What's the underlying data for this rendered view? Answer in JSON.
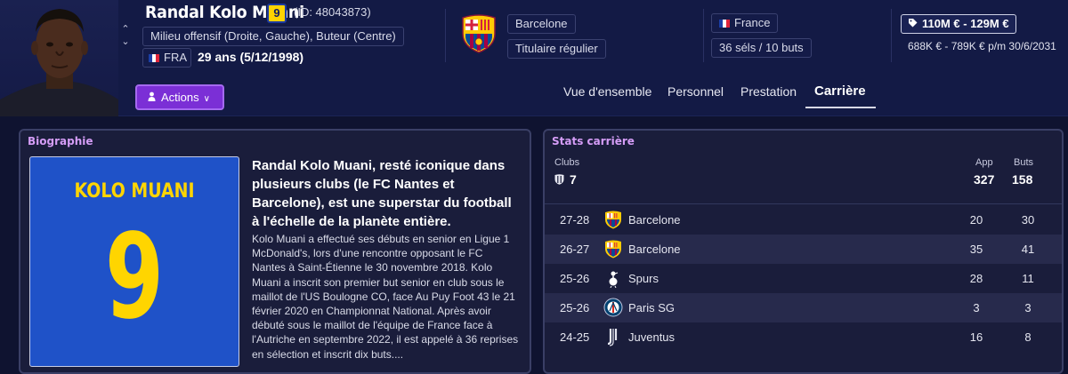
{
  "player": {
    "name": "Randal Kolo Muani",
    "shirt_number": "9",
    "id_text": "(ID: 48043873)",
    "position": "Milieu offensif (Droite, Gauche), Buteur (Centre)",
    "nationality_code": "FRA",
    "age": "29 ans (5/12/1998)"
  },
  "actions": {
    "label": "Actions"
  },
  "club": {
    "name": "Barcelone",
    "status": "Titulaire régulier",
    "crest_icon": "fc-barcelona-crest-icon"
  },
  "national_team": {
    "country": "France",
    "caps_goals": "36 séls / 10 buts"
  },
  "value": {
    "range": "110M € - 129M €",
    "wage_contract": "688K € - 789K € p/m 30/6/2031"
  },
  "tabs": [
    {
      "label": "Vue d'ensemble"
    },
    {
      "label": "Personnel"
    },
    {
      "label": "Prestation"
    },
    {
      "label": "Carrière",
      "active": true
    }
  ],
  "biography": {
    "title": "Biographie",
    "jersey_name": "KOLO MUANI",
    "jersey_number": "9",
    "headline": "Randal Kolo Muani, resté iconique dans plusieurs clubs (le FC Nantes et Barcelone), est une superstar du football à l'échelle de la planète entière.",
    "body": "Kolo Muani a effectué ses débuts en senior en Ligue 1 McDonald's, lors d'une rencontre opposant le FC Nantes à Saint-Étienne le 30 novembre 2018. Kolo Muani a inscrit son premier but senior en club sous le maillot de l'US Boulogne CO, face Au Puy Foot 43 le 21 février 2020 en Championnat National. Après avoir débuté sous le maillot de l'équipe de France face à l'Autriche en septembre 2022, il est appelé à 36 reprises en sélection et inscrit dix buts...."
  },
  "career_stats": {
    "title": "Stats carrière",
    "clubs_label": "Clubs",
    "clubs_count": "7",
    "apps_label": "App",
    "apps_total": "327",
    "goals_label": "Buts",
    "goals_total": "158",
    "rows": [
      {
        "season": "27-28",
        "club": "Barcelone",
        "apps": "20",
        "goals": "30",
        "crest": "barcelona-crest-icon"
      },
      {
        "season": "26-27",
        "club": "Barcelone",
        "apps": "35",
        "goals": "41",
        "crest": "barcelona-crest-icon"
      },
      {
        "season": "25-26",
        "club": "Spurs",
        "apps": "28",
        "goals": "11",
        "crest": "spurs-crest-icon"
      },
      {
        "season": "25-26",
        "club": "Paris SG",
        "apps": "3",
        "goals": "3",
        "crest": "psg-crest-icon"
      },
      {
        "season": "24-25",
        "club": "Juventus",
        "apps": "16",
        "goals": "8",
        "crest": "juventus-crest-icon"
      }
    ]
  },
  "colors": {
    "background": "#0f1330",
    "header": "#131a45",
    "accent_purple": "#7b2fd6",
    "panel_title": "#d59df7",
    "jersey_blue": "#1f52c8",
    "jersey_yellow": "#ffd500"
  }
}
